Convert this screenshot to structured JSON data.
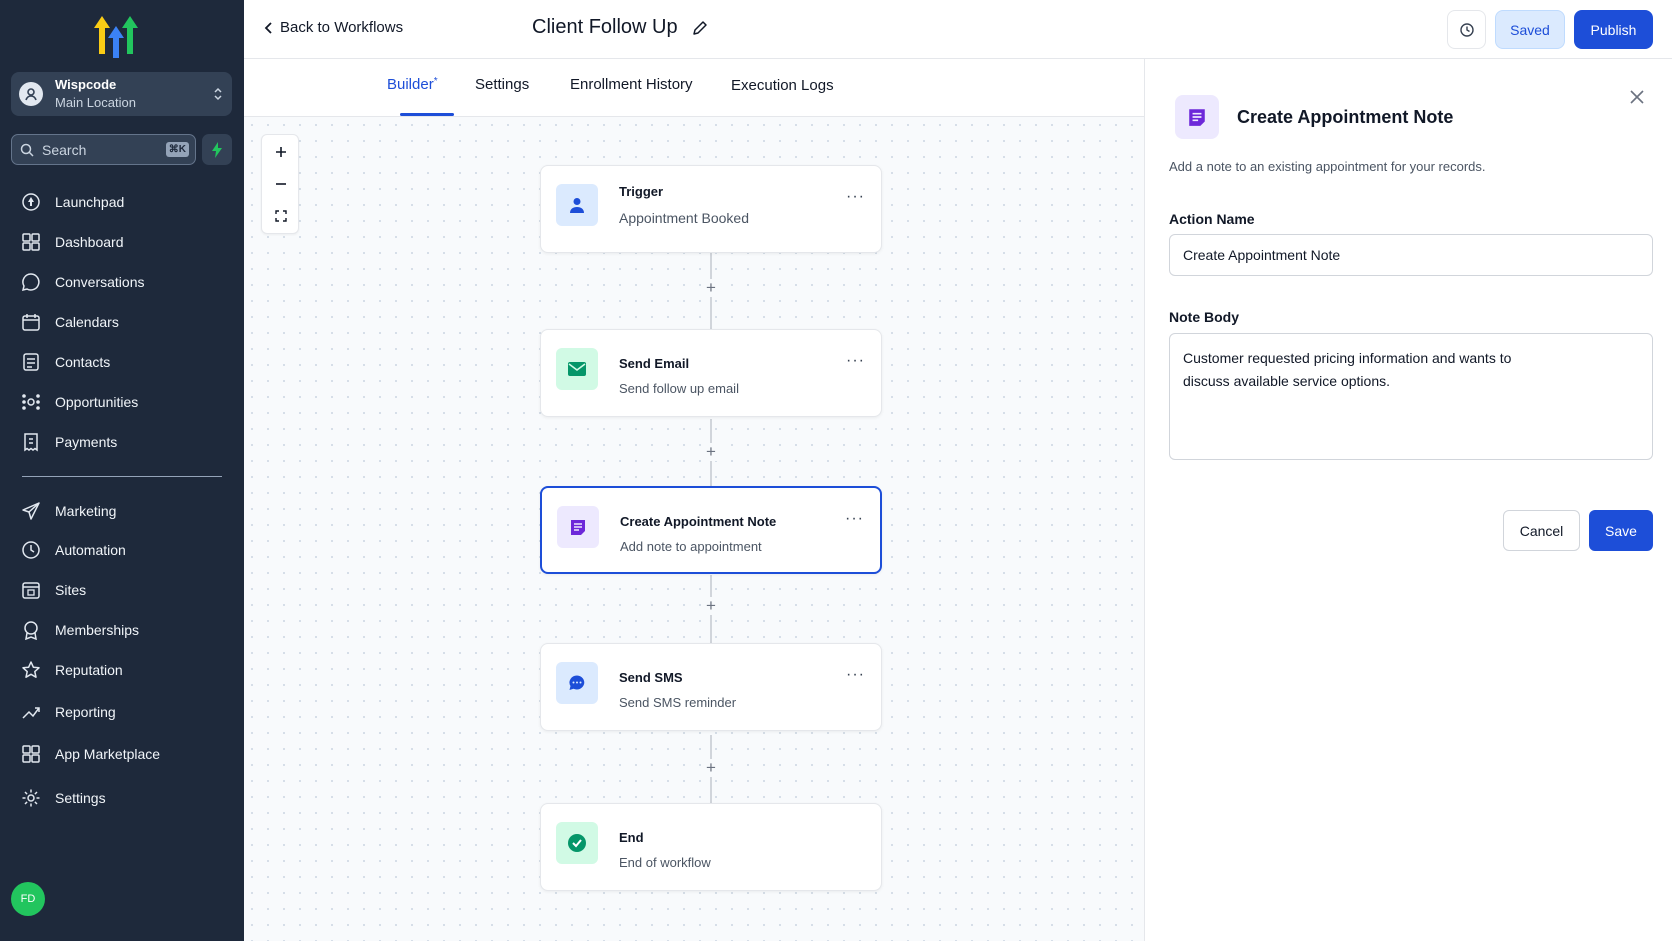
{
  "sidebar": {
    "location": {
      "name": "Wispcode",
      "sub": "Main Location"
    },
    "search": {
      "placeholder": "Search",
      "shortcut": "⌘K"
    },
    "items": [
      {
        "label": "Launchpad",
        "icon": "launchpad-icon"
      },
      {
        "label": "Dashboard",
        "icon": "dashboard-icon"
      },
      {
        "label": "Conversations",
        "icon": "conversations-icon"
      },
      {
        "label": "Calendars",
        "icon": "calendar-icon"
      },
      {
        "label": "Contacts",
        "icon": "contacts-icon"
      },
      {
        "label": "Opportunities",
        "icon": "opportunities-icon"
      },
      {
        "label": "Payments",
        "icon": "payments-icon"
      },
      {
        "label": "Marketing",
        "icon": "marketing-icon"
      },
      {
        "label": "Automation",
        "icon": "automation-icon"
      },
      {
        "label": "Sites",
        "icon": "sites-icon"
      },
      {
        "label": "Memberships",
        "icon": "memberships-icon"
      },
      {
        "label": "Reputation",
        "icon": "star-icon"
      },
      {
        "label": "Reporting",
        "icon": "reporting-icon"
      },
      {
        "label": "App Marketplace",
        "icon": "app-marketplace-icon"
      },
      {
        "label": "Settings",
        "icon": "gear-icon"
      }
    ],
    "user_initials": "FD"
  },
  "header": {
    "back_label": "Back to Workflows",
    "title": "Client Follow Up",
    "saved_label": "Saved",
    "publish_label": "Publish"
  },
  "tabs": [
    {
      "label": "Builder",
      "marker": "*",
      "active": true
    },
    {
      "label": "Settings"
    },
    {
      "label": "Enrollment History"
    },
    {
      "label": "Execution Logs"
    }
  ],
  "nodes": [
    {
      "title": "Trigger",
      "subtitle": "Appointment Booked",
      "icon": "user-icon",
      "color": "#1d4ed8",
      "bg": "#dbeafe"
    },
    {
      "title": "Send Email",
      "subtitle": "Send follow up email",
      "icon": "mail-icon",
      "color": "#059669",
      "bg": "#d1fae5"
    },
    {
      "title": "Create Appointment Note",
      "subtitle": "Add note to appointment",
      "icon": "note-icon",
      "color": "#6d28d9",
      "bg": "#ede9fe",
      "selected": true
    },
    {
      "title": "Send SMS",
      "subtitle": "Send SMS reminder",
      "icon": "chat-icon",
      "color": "#1d4ed8",
      "bg": "#dbeafe"
    },
    {
      "title": "End",
      "subtitle": "End of workflow",
      "icon": "check-circle-icon",
      "color": "#059669",
      "bg": "#d1fae5"
    }
  ],
  "panel": {
    "title": "Create Appointment Note",
    "description": "Add a note to an existing appointment for your records.",
    "action_name_label": "Action Name",
    "action_name_value": "Create Appointment Note",
    "note_body_label": "Note Body",
    "note_body_value": "Customer requested pricing information and wants to\ndiscuss available service options.",
    "cancel_label": "Cancel",
    "save_label": "Save"
  },
  "colors": {
    "accent": "#1d4ed8",
    "sidebar_bg": "#1e293b",
    "success": "#22c55e",
    "note_purple": "#6d28d9"
  }
}
